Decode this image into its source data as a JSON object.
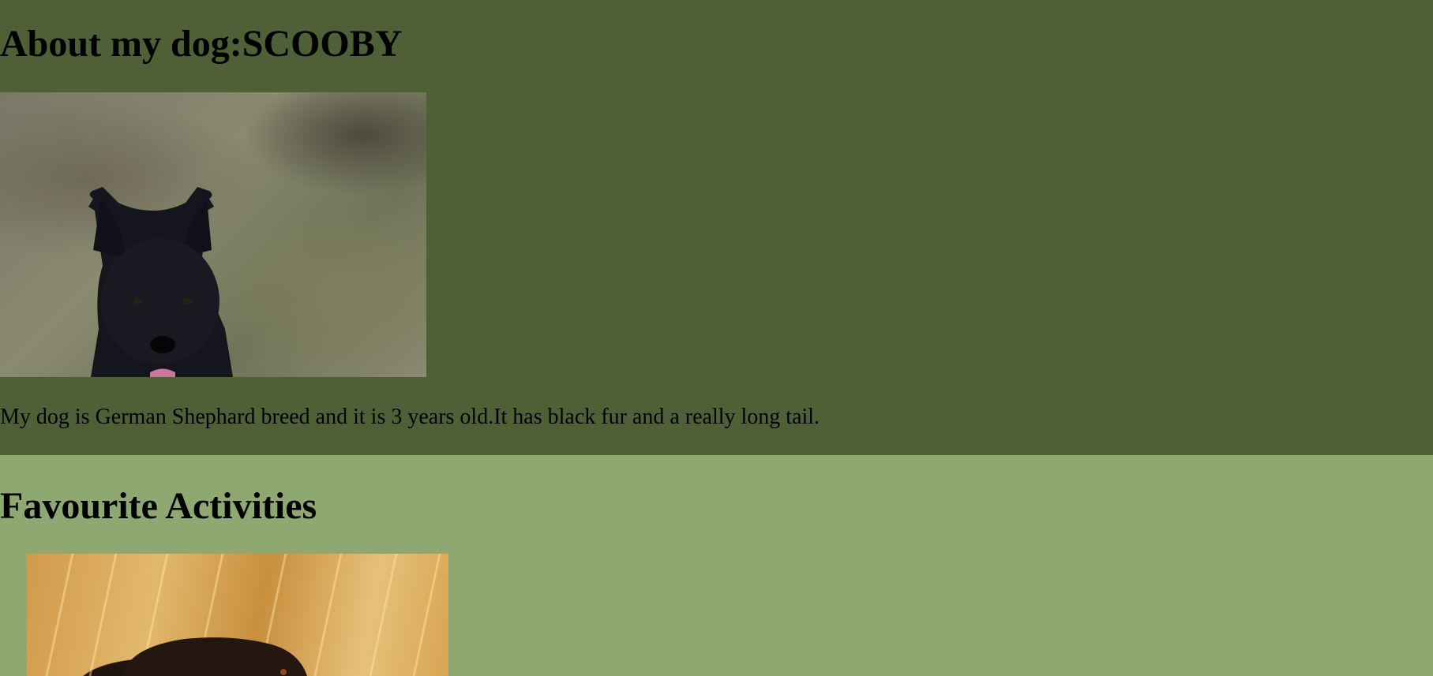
{
  "about": {
    "title": "About my dog:SCOOBY",
    "photo_icon": "black-german-shepherd-photo",
    "description": "My dog is German Shephard breed and it is 3 years old.It has black fur and a really long tail."
  },
  "activities": {
    "title": "Favourite Activities",
    "photo_icon": "dog-in-wheat-field-photo"
  },
  "colors": {
    "top_background": "#4f5f36",
    "bottom_background": "#8fa871",
    "text": "#000000"
  }
}
